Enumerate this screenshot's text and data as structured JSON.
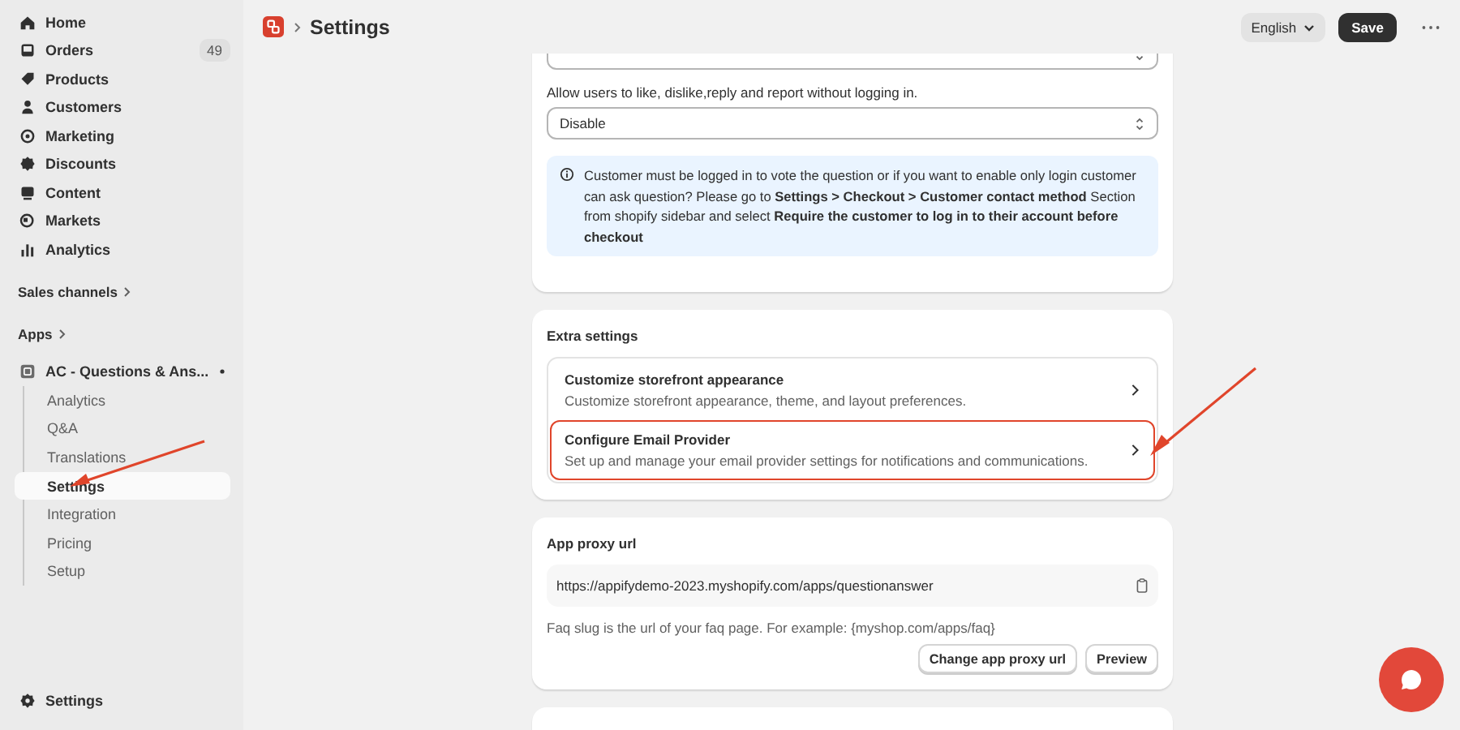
{
  "sidebar": {
    "nav": [
      {
        "label": "Home"
      },
      {
        "label": "Orders",
        "badge": "49"
      },
      {
        "label": "Products"
      },
      {
        "label": "Customers"
      },
      {
        "label": "Marketing"
      },
      {
        "label": "Discounts"
      },
      {
        "label": "Content"
      },
      {
        "label": "Markets"
      },
      {
        "label": "Analytics"
      }
    ],
    "sales_channels": "Sales channels",
    "apps": "Apps",
    "app": {
      "name": "AC - Questions & Ans...",
      "items": [
        {
          "label": "Analytics",
          "selected": false
        },
        {
          "label": "Q&A",
          "selected": false
        },
        {
          "label": "Translations",
          "selected": false
        },
        {
          "label": "Settings",
          "selected": true
        },
        {
          "label": "Integration",
          "selected": false
        },
        {
          "label": "Pricing",
          "selected": false
        },
        {
          "label": "Setup",
          "selected": false
        }
      ]
    },
    "footer": "Settings"
  },
  "header": {
    "title": "Settings",
    "language": "English",
    "save": "Save"
  },
  "login_card": {
    "label": "Allow users to like, dislike,reply and report without logging in.",
    "select": "Disable",
    "notice": "Customer must be logged in to vote the question or if you want to enable only login customer can ask question? Please go to **Settings > Checkout > Customer contact method** Section from shopify sidebar and select **Require the customer to log in to their account before checkout**"
  },
  "extra_settings": {
    "title": "Extra settings",
    "items": [
      {
        "title": "Customize storefront appearance",
        "description": "Customize storefront appearance, theme, and layout preferences.",
        "highlighted": false
      },
      {
        "title": "Configure Email Provider",
        "description": "Set up and manage your email provider settings for notifications and communications.",
        "highlighted": true
      }
    ]
  },
  "proxy": {
    "title": "App proxy url",
    "url": "https://appifydemo-2023.myshopify.com/apps/questionanswer",
    "hint": "Faq slug is the url of your faq page. For example: {myshop.com/apps/faq}",
    "buttons": [
      "Change app proxy url",
      "Preview"
    ]
  }
}
